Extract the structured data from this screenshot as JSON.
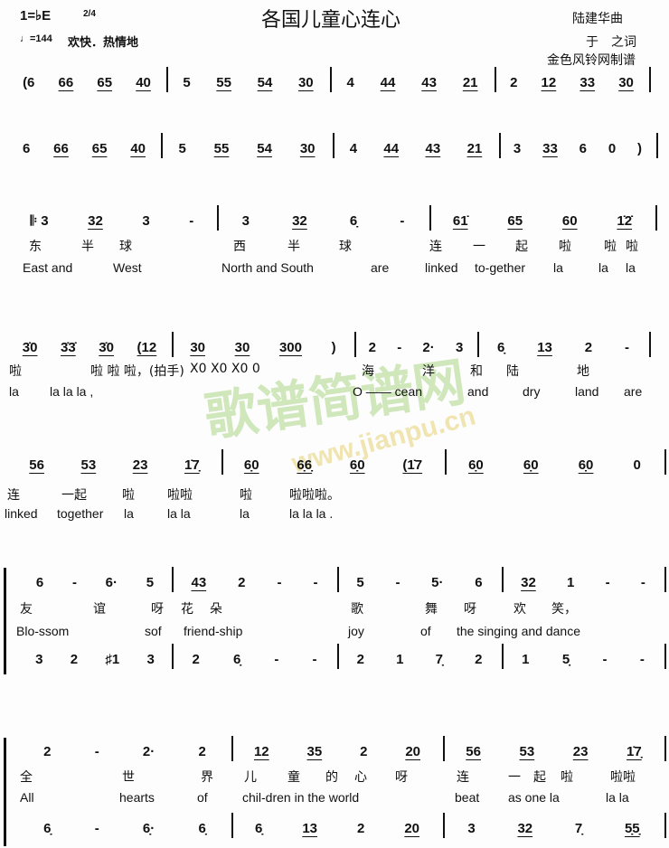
{
  "header": {
    "key": "1=♭E",
    "time": "2/4",
    "tempo": "♩=144",
    "expression": "欢快．热情地",
    "title": "各国儿童心连心",
    "composer": "陆建华曲",
    "lyricist": "于　之词",
    "maker": "金色风铃网制谱"
  },
  "watermark": {
    "text": "歌谱简谱网",
    "url": "www.jianpu.cn"
  },
  "rows": [
    {
      "measures": [
        [
          "(6",
          "66",
          "65",
          "40"
        ],
        [
          "5",
          "55",
          "54",
          "30"
        ],
        [
          "4",
          "44",
          "43",
          "21"
        ],
        [
          "2",
          "12",
          "33",
          "30"
        ]
      ]
    },
    {
      "measures": [
        [
          "6",
          "66",
          "65",
          "40"
        ],
        [
          "5",
          "55",
          "54",
          "30"
        ],
        [
          "4",
          "44",
          "43",
          "21"
        ],
        [
          "3",
          "33",
          "6",
          "0",
          ")"
        ]
      ]
    },
    {
      "measures": [
        [
          "𝄆 3",
          "32",
          "3",
          "-"
        ],
        [
          "3",
          "32",
          "6̣",
          "-"
        ],
        [
          "61̇",
          "65",
          "60",
          "1̇2̇"
        ]
      ],
      "zh": [
        "东",
        "半",
        "球",
        "西",
        "半",
        "球",
        "连",
        "一",
        "起",
        "啦",
        "啦",
        "啦"
      ],
      "en": [
        "East and",
        "West",
        "North and South",
        "are",
        "linked",
        "to-gether",
        "la",
        "la",
        "la"
      ]
    },
    {
      "measures": [
        [
          "3̇0",
          "3̇3̇",
          "3̇0",
          "(12"
        ],
        [
          "30",
          "30",
          "300",
          ")"
        ],
        [
          "2",
          "-",
          "2·",
          "3"
        ],
        [
          "6̣",
          "13",
          "2",
          "-"
        ]
      ],
      "zh": [
        "啦",
        "啦 啦 啦，(拍手)",
        "X0  X0  X0 0",
        "海",
        "洋",
        "和",
        "陆",
        "地"
      ],
      "en": [
        "la",
        "la la la ,",
        "O —— cean",
        "and",
        "dry",
        "land",
        "are"
      ]
    },
    {
      "measures": [
        [
          "56",
          "53",
          "23",
          "1̇7̣"
        ],
        [
          "6̣0",
          "6̣6̣",
          "6̣0",
          "(1̇7"
        ],
        [
          "6̣0",
          "6̣0",
          "6̣0",
          "0"
        ]
      ],
      "zh": [
        "连",
        "一起",
        "啦",
        "啦啦",
        "啦",
        "啦啦啦。"
      ],
      "en": [
        "linked",
        "together",
        "la",
        "la la",
        "la",
        "la la la ."
      ]
    },
    {
      "measures": [
        [
          "6",
          "-",
          "6·",
          "5"
        ],
        [
          "43",
          "2",
          "-",
          "-"
        ],
        [
          "5",
          "-",
          "5·",
          "6"
        ],
        [
          "32",
          "1",
          "-",
          "-"
        ]
      ],
      "zh": [
        "友",
        "谊",
        "呀",
        "花",
        "朵",
        "歌",
        "舞",
        "呀",
        "欢",
        "笑，"
      ],
      "en": [
        "Blo-ssom",
        "sof",
        "friend-ship",
        "joy",
        "of",
        "the singing and dance"
      ],
      "lower": [
        [
          "3",
          "2",
          "♯1",
          "3"
        ],
        [
          "2",
          "6̣",
          "-",
          "-"
        ],
        [
          "2",
          "1",
          "7̣",
          "2"
        ],
        [
          "1",
          "5̣",
          "-",
          "-"
        ]
      ]
    },
    {
      "measures": [
        [
          "2",
          "-",
          "2·",
          "2"
        ],
        [
          "12",
          "35",
          "2",
          "20"
        ],
        [
          "56",
          "53",
          "23",
          "1̇7̣"
        ]
      ],
      "zh": [
        "全",
        "世",
        "界",
        "儿",
        "童",
        "的",
        "心",
        "呀",
        "连",
        "一",
        "起",
        "啦",
        "啦啦"
      ],
      "en": [
        "All",
        "hearts",
        "of",
        "chil-dren in the world",
        "beat",
        "as one la",
        "la la"
      ],
      "lower": [
        [
          "6̣",
          "-",
          "6̣·",
          "6̣"
        ],
        [
          "6̣",
          "13",
          "2",
          "20"
        ],
        [
          "3",
          "32",
          "7̣",
          "5̣5̣"
        ]
      ]
    }
  ]
}
